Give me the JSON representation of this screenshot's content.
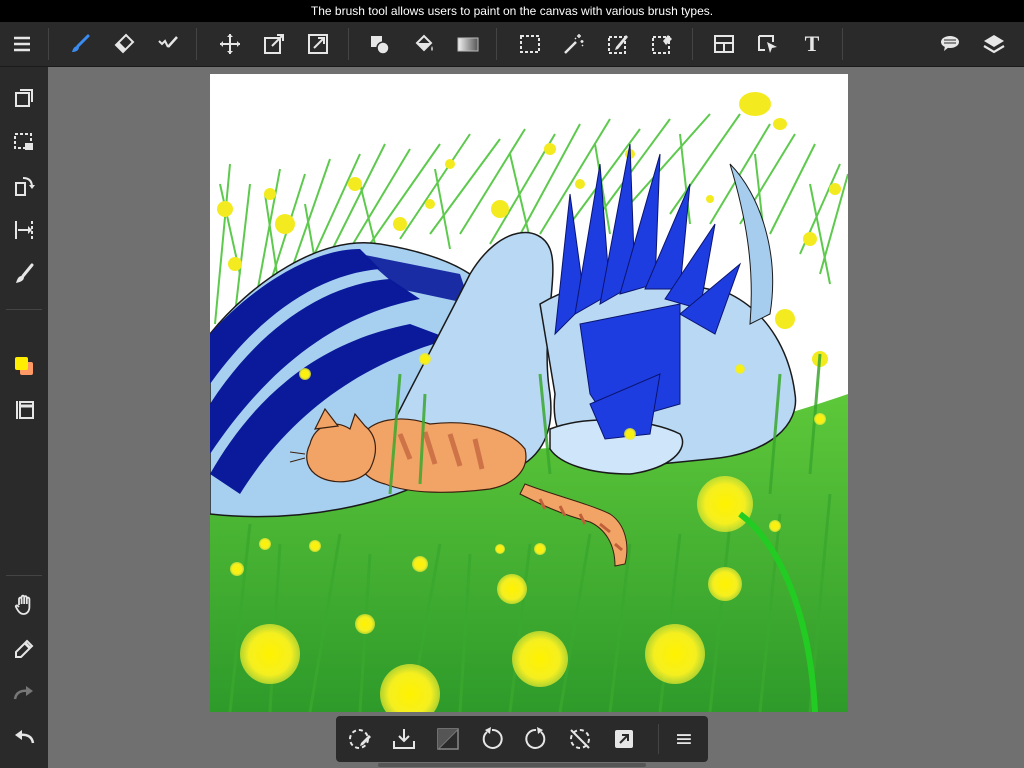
{
  "tooltip": {
    "text": "The brush tool allows users to paint on the canvas with various brush types."
  },
  "toolbar": {
    "text_tool_label": "T",
    "active_tool": "brush-tool",
    "accent_color": "#3a8cf0",
    "icon_color": "#e6e6e6"
  },
  "sidebar": {
    "main_color": "#ffee00",
    "sub_color": "#ff9966"
  },
  "bottombar": {
    "menu_glyph": "≡"
  },
  "canvas": {
    "background": "#ffffff",
    "subject": "painted artwork of a sleeping blue dragon and an orange cat in a grassy field with yellow flowers"
  }
}
